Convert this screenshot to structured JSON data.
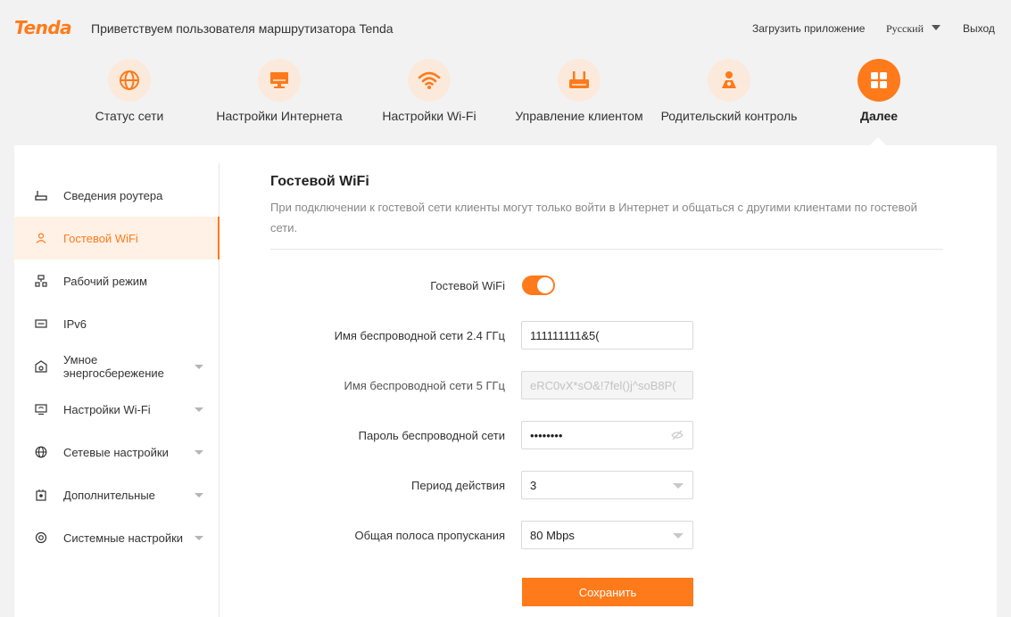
{
  "header": {
    "logo": "Tenda",
    "welcome": "Приветствуем пользователя маршрутизатора Tenda",
    "app_link": "Загрузить приложение",
    "language": "Русский",
    "logout": "Выход"
  },
  "nav": {
    "items": [
      {
        "label": "Статус сети",
        "icon": "globe-icon"
      },
      {
        "label": "Настройки Интернета",
        "icon": "monitor-icon"
      },
      {
        "label": "Настройки Wi-Fi",
        "icon": "wifi-icon"
      },
      {
        "label": "Управление клиентом",
        "icon": "router-icon"
      },
      {
        "label": "Родительский контроль",
        "icon": "parent-icon"
      },
      {
        "label": "Далее",
        "icon": "grid-icon"
      }
    ]
  },
  "sidebar": {
    "items": [
      {
        "label": "Сведения роутера",
        "icon": "router-info-icon"
      },
      {
        "label": "Гостевой WiFi",
        "icon": "guest-icon"
      },
      {
        "label": "Рабочий режим",
        "icon": "mode-icon"
      },
      {
        "label": "IPv6",
        "icon": "ipv6-icon"
      },
      {
        "label": "Умное энергосбережение",
        "icon": "energy-icon"
      },
      {
        "label": "Настройки Wi-Fi",
        "icon": "wifi-settings-icon"
      },
      {
        "label": "Сетевые настройки",
        "icon": "network-icon"
      },
      {
        "label": "Дополнительные",
        "icon": "advanced-icon"
      },
      {
        "label": "Системные настройки",
        "icon": "system-icon"
      }
    ]
  },
  "section": {
    "title": "Гостевой WiFi",
    "description": "При подключении к гостевой сети клиенты могут только войти в Интернет и общаться с другими клиентами по гостевой сети."
  },
  "form": {
    "guest_wifi_label": "Гостевой WiFi",
    "ssid24_label": "Имя беспроводной сети 2.4 ГГц",
    "ssid24_value": "111111111&5(",
    "ssid5_label": "Имя беспроводной сети 5 ГГц",
    "ssid5_value": "eRC0vX*sO&!7fel()j^soB8P(",
    "password_label": "Пароль беспроводной сети",
    "password_value": "••••••••",
    "period_label": "Период действия",
    "period_value": "3",
    "bandwidth_label": "Общая полоса пропускания",
    "bandwidth_value": "80 Mbps",
    "save_label": "Сохранить"
  },
  "colors": {
    "accent": "#ff7a1a",
    "accent_light": "#fbeadc"
  }
}
